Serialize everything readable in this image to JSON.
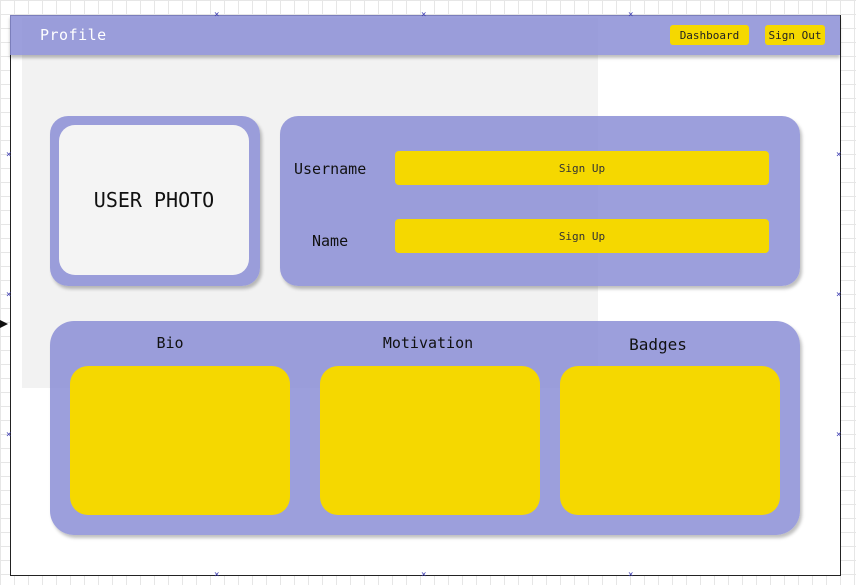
{
  "header": {
    "title": "Profile",
    "dashboard_label": "Dashboard",
    "signout_label": "Sign Out"
  },
  "photo": {
    "label": "USER PHOTO"
  },
  "fields": [
    {
      "label": "Username",
      "value": "Sign Up"
    },
    {
      "label": "Name",
      "value": "Sign Up"
    }
  ],
  "sections": [
    {
      "label": "Bio"
    },
    {
      "label": "Motivation"
    },
    {
      "label": "Badges"
    }
  ],
  "colors": {
    "panel": "#8b8ed6",
    "accent": "#f5d800",
    "canvas": "#ffffff",
    "background_panel": "#f2f2f2"
  },
  "icons": {
    "selection_handle": "x-marker-icon"
  }
}
